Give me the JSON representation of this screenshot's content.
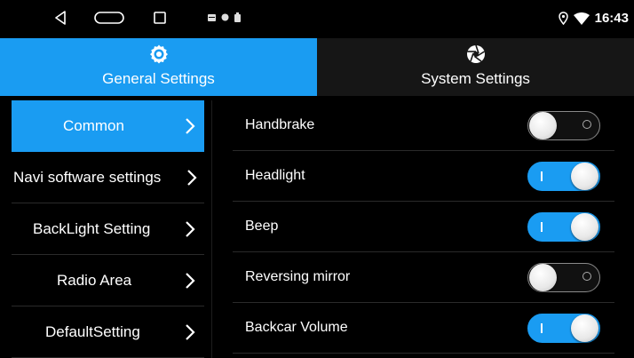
{
  "status_bar": {
    "time": "16:43",
    "icons": [
      "back-icon",
      "home-icon",
      "recent-apps-icon",
      "notification-icons",
      "location-icon",
      "wifi-icon"
    ]
  },
  "tabs": [
    {
      "label": "General Settings",
      "icon": "gear-icon",
      "active": true
    },
    {
      "label": "System Settings",
      "icon": "aperture-icon",
      "active": false
    }
  ],
  "menu": {
    "items": [
      {
        "label": "Common",
        "active": true
      },
      {
        "label": "Navi software settings",
        "active": false
      },
      {
        "label": "BackLight Setting",
        "active": false
      },
      {
        "label": "Radio Area",
        "active": false
      },
      {
        "label": "DefaultSetting",
        "active": false
      }
    ]
  },
  "settings": {
    "rows": [
      {
        "label": "Handbrake",
        "on": false
      },
      {
        "label": "Headlight",
        "on": true
      },
      {
        "label": "Beep",
        "on": true
      },
      {
        "label": "Reversing mirror",
        "on": false
      },
      {
        "label": "Backcar Volume",
        "on": true
      }
    ]
  },
  "colors": {
    "accent": "#1a9cf2",
    "background": "#000000",
    "inactive_tab": "#161616"
  }
}
